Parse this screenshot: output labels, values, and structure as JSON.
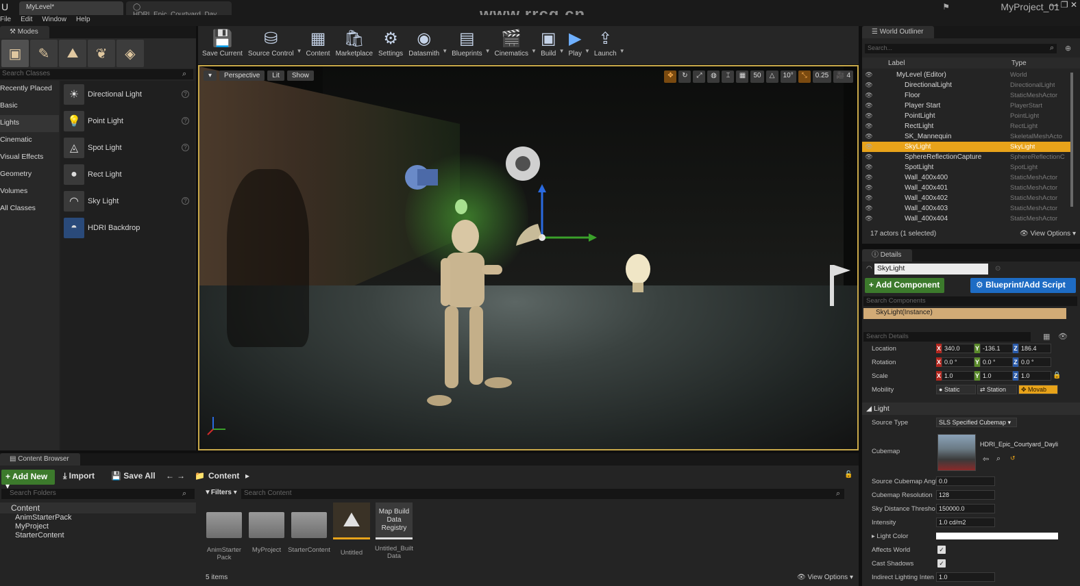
{
  "title_bar": {
    "tabs": [
      "MyLevel*",
      "HDRI_Epic_Courtyard_Day"
    ],
    "watermark": "www.rrcg.cn",
    "project": "MyProject_01",
    "window_controls": [
      "—",
      "❐",
      "✕"
    ]
  },
  "menu": [
    "File",
    "Edit",
    "Window",
    "Help"
  ],
  "modes": {
    "tab_label": "Modes",
    "search_placeholder": "Search Classes",
    "categories": [
      "Recently Placed",
      "Basic",
      "Lights",
      "Cinematic",
      "Visual Effects",
      "Geometry",
      "Volumes",
      "All Classes"
    ],
    "selected_category": "Lights",
    "items": [
      "Directional Light",
      "Point Light",
      "Spot Light",
      "Rect Light",
      "Sky Light",
      "HDRI Backdrop"
    ]
  },
  "toolbar": [
    {
      "label": "Save Current",
      "icon": "💾"
    },
    {
      "label": "Source Control",
      "icon": "⛁"
    },
    {
      "label": "Content",
      "icon": "▦"
    },
    {
      "label": "Marketplace",
      "icon": "🛍"
    },
    {
      "label": "Settings",
      "icon": "⚙"
    },
    {
      "label": "Datasmith",
      "icon": "◉"
    },
    {
      "label": "Blueprints",
      "icon": "▤"
    },
    {
      "label": "Cinematics",
      "icon": "🎬"
    },
    {
      "label": "Build",
      "icon": "▣"
    },
    {
      "label": "Play",
      "icon": "▶"
    },
    {
      "label": "Launch",
      "icon": "⇪"
    }
  ],
  "viewport": {
    "buttons": [
      "Perspective",
      "Lit",
      "Show"
    ],
    "grid_snap": "50",
    "rotation_snap": "10°",
    "scale_snap": "0.25",
    "camera_speed": "4"
  },
  "outliner": {
    "tab_label": "World Outliner",
    "search_placeholder": "Search...",
    "columns": {
      "label": "Label",
      "type": "Type"
    },
    "rows": [
      {
        "name": "MyLevel (Editor)",
        "type": "World"
      },
      {
        "name": "DirectionalLight",
        "type": "DirectionalLight"
      },
      {
        "name": "Floor",
        "type": "StaticMeshActor"
      },
      {
        "name": "Player Start",
        "type": "PlayerStart"
      },
      {
        "name": "PointLight",
        "type": "PointLight"
      },
      {
        "name": "RectLight",
        "type": "RectLight"
      },
      {
        "name": "SK_Mannequin",
        "type": "SkeletalMeshActo"
      },
      {
        "name": "SkyLight",
        "type": "SkyLight"
      },
      {
        "name": "SphereReflectionCapture",
        "type": "SphereReflectionC"
      },
      {
        "name": "SpotLight",
        "type": "SpotLight"
      },
      {
        "name": "Wall_400x400",
        "type": "StaticMeshActor"
      },
      {
        "name": "Wall_400x401",
        "type": "StaticMeshActor"
      },
      {
        "name": "Wall_400x402",
        "type": "StaticMeshActor"
      },
      {
        "name": "Wall_400x403",
        "type": "StaticMeshActor"
      },
      {
        "name": "Wall_400x404",
        "type": "StaticMeshActor"
      }
    ],
    "selected": "SkyLight",
    "status": "17 actors (1 selected)",
    "view_options": "View Options"
  },
  "details": {
    "tab_label": "Details",
    "actor_name": "SkyLight",
    "add_component": "+ Add Component",
    "blueprint_script": "Blueprint/Add Script",
    "search_components": "Search Components",
    "instance": "SkyLight(Instance)",
    "search_details": "Search Details",
    "transform": {
      "location": {
        "label": "Location",
        "x": "340.0",
        "y": "-136.1",
        "z": "186.4"
      },
      "rotation": {
        "label": "Rotation",
        "x": "0.0 °",
        "y": "0.0 °",
        "z": "0.0 °"
      },
      "scale": {
        "label": "Scale",
        "x": "1.0",
        "y": "1.0",
        "z": "1.0"
      }
    },
    "mobility": {
      "label": "Mobility",
      "options": [
        "Static",
        "Station",
        "Movab"
      ],
      "selected": "Movab"
    },
    "light_section": "Light",
    "source_type": {
      "label": "Source Type",
      "value": "SLS Specified Cubemap"
    },
    "cubemap": {
      "label": "Cubemap",
      "value": "HDRI_Epic_Courtyard_Dayli"
    },
    "props": [
      {
        "label": "Source Cubemap Angl",
        "value": "0.0"
      },
      {
        "label": "Cubemap Resolution",
        "value": "128"
      },
      {
        "label": "Sky Distance Thresho",
        "value": "150000.0"
      },
      {
        "label": "Intensity",
        "value": "1.0 cd/m2"
      }
    ],
    "light_color": "Light Color",
    "affects_world": "Affects World",
    "cast_shadows": "Cast Shadows",
    "indirect": {
      "label": "Indirect Lighting Inten",
      "value": "1.0"
    }
  },
  "content_browser": {
    "tab_label": "Content Browser",
    "add_new": "Add New",
    "import": "Import",
    "save_all": "Save All",
    "path": "Content",
    "search_folders": "Search Folders",
    "folders": [
      "Content",
      "AnimStarterPack",
      "MyProject",
      "StarterContent"
    ],
    "filters": "Filters",
    "search_content": "Search Content",
    "assets": [
      {
        "label": "AnimStarter Pack",
        "kind": "folder"
      },
      {
        "label": "MyProject",
        "kind": "folder"
      },
      {
        "label": "StarterContent",
        "kind": "folder"
      },
      {
        "label": "Untitled",
        "kind": "level"
      },
      {
        "label": "Untitled_Built Data",
        "kind": "data",
        "thumb_text": "Map Build Data Registry"
      }
    ],
    "status": "5 items",
    "view_options": "View Options"
  },
  "colors": {
    "accent_selection": "#e8a31a",
    "add_green": "#3c7a2c",
    "blueprint_blue": "#1e6cc4",
    "instance_tan": "#d2ab76"
  }
}
